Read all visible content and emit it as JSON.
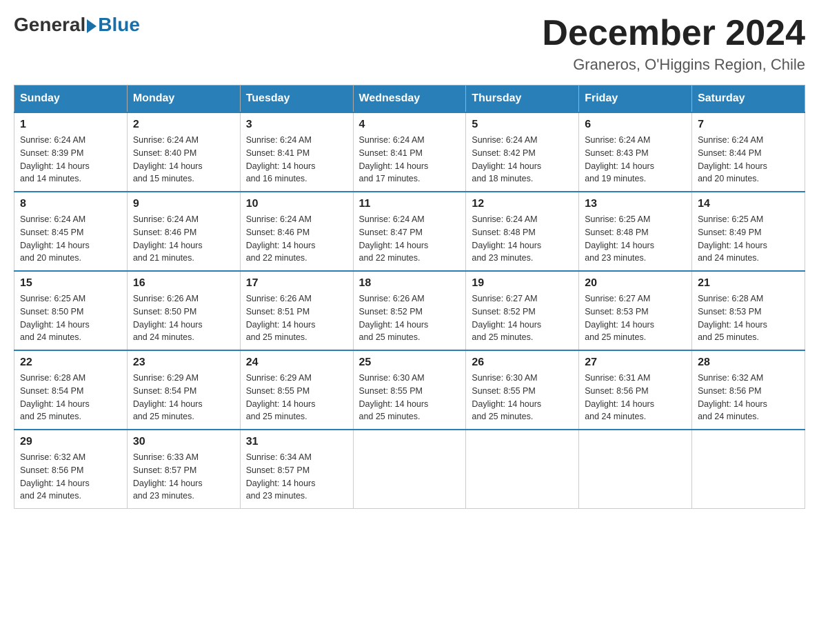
{
  "header": {
    "logo_general": "General",
    "logo_blue": "Blue",
    "month_title": "December 2024",
    "location": "Graneros, O'Higgins Region, Chile"
  },
  "days_of_week": [
    "Sunday",
    "Monday",
    "Tuesday",
    "Wednesday",
    "Thursday",
    "Friday",
    "Saturday"
  ],
  "weeks": [
    [
      {
        "day": "1",
        "sunrise": "6:24 AM",
        "sunset": "8:39 PM",
        "daylight": "14 hours and 14 minutes."
      },
      {
        "day": "2",
        "sunrise": "6:24 AM",
        "sunset": "8:40 PM",
        "daylight": "14 hours and 15 minutes."
      },
      {
        "day": "3",
        "sunrise": "6:24 AM",
        "sunset": "8:41 PM",
        "daylight": "14 hours and 16 minutes."
      },
      {
        "day": "4",
        "sunrise": "6:24 AM",
        "sunset": "8:41 PM",
        "daylight": "14 hours and 17 minutes."
      },
      {
        "day": "5",
        "sunrise": "6:24 AM",
        "sunset": "8:42 PM",
        "daylight": "14 hours and 18 minutes."
      },
      {
        "day": "6",
        "sunrise": "6:24 AM",
        "sunset": "8:43 PM",
        "daylight": "14 hours and 19 minutes."
      },
      {
        "day": "7",
        "sunrise": "6:24 AM",
        "sunset": "8:44 PM",
        "daylight": "14 hours and 20 minutes."
      }
    ],
    [
      {
        "day": "8",
        "sunrise": "6:24 AM",
        "sunset": "8:45 PM",
        "daylight": "14 hours and 20 minutes."
      },
      {
        "day": "9",
        "sunrise": "6:24 AM",
        "sunset": "8:46 PM",
        "daylight": "14 hours and 21 minutes."
      },
      {
        "day": "10",
        "sunrise": "6:24 AM",
        "sunset": "8:46 PM",
        "daylight": "14 hours and 22 minutes."
      },
      {
        "day": "11",
        "sunrise": "6:24 AM",
        "sunset": "8:47 PM",
        "daylight": "14 hours and 22 minutes."
      },
      {
        "day": "12",
        "sunrise": "6:24 AM",
        "sunset": "8:48 PM",
        "daylight": "14 hours and 23 minutes."
      },
      {
        "day": "13",
        "sunrise": "6:25 AM",
        "sunset": "8:48 PM",
        "daylight": "14 hours and 23 minutes."
      },
      {
        "day": "14",
        "sunrise": "6:25 AM",
        "sunset": "8:49 PM",
        "daylight": "14 hours and 24 minutes."
      }
    ],
    [
      {
        "day": "15",
        "sunrise": "6:25 AM",
        "sunset": "8:50 PM",
        "daylight": "14 hours and 24 minutes."
      },
      {
        "day": "16",
        "sunrise": "6:26 AM",
        "sunset": "8:50 PM",
        "daylight": "14 hours and 24 minutes."
      },
      {
        "day": "17",
        "sunrise": "6:26 AM",
        "sunset": "8:51 PM",
        "daylight": "14 hours and 25 minutes."
      },
      {
        "day": "18",
        "sunrise": "6:26 AM",
        "sunset": "8:52 PM",
        "daylight": "14 hours and 25 minutes."
      },
      {
        "day": "19",
        "sunrise": "6:27 AM",
        "sunset": "8:52 PM",
        "daylight": "14 hours and 25 minutes."
      },
      {
        "day": "20",
        "sunrise": "6:27 AM",
        "sunset": "8:53 PM",
        "daylight": "14 hours and 25 minutes."
      },
      {
        "day": "21",
        "sunrise": "6:28 AM",
        "sunset": "8:53 PM",
        "daylight": "14 hours and 25 minutes."
      }
    ],
    [
      {
        "day": "22",
        "sunrise": "6:28 AM",
        "sunset": "8:54 PM",
        "daylight": "14 hours and 25 minutes."
      },
      {
        "day": "23",
        "sunrise": "6:29 AM",
        "sunset": "8:54 PM",
        "daylight": "14 hours and 25 minutes."
      },
      {
        "day": "24",
        "sunrise": "6:29 AM",
        "sunset": "8:55 PM",
        "daylight": "14 hours and 25 minutes."
      },
      {
        "day": "25",
        "sunrise": "6:30 AM",
        "sunset": "8:55 PM",
        "daylight": "14 hours and 25 minutes."
      },
      {
        "day": "26",
        "sunrise": "6:30 AM",
        "sunset": "8:55 PM",
        "daylight": "14 hours and 25 minutes."
      },
      {
        "day": "27",
        "sunrise": "6:31 AM",
        "sunset": "8:56 PM",
        "daylight": "14 hours and 24 minutes."
      },
      {
        "day": "28",
        "sunrise": "6:32 AM",
        "sunset": "8:56 PM",
        "daylight": "14 hours and 24 minutes."
      }
    ],
    [
      {
        "day": "29",
        "sunrise": "6:32 AM",
        "sunset": "8:56 PM",
        "daylight": "14 hours and 24 minutes."
      },
      {
        "day": "30",
        "sunrise": "6:33 AM",
        "sunset": "8:57 PM",
        "daylight": "14 hours and 23 minutes."
      },
      {
        "day": "31",
        "sunrise": "6:34 AM",
        "sunset": "8:57 PM",
        "daylight": "14 hours and 23 minutes."
      },
      null,
      null,
      null,
      null
    ]
  ],
  "labels": {
    "sunrise": "Sunrise:",
    "sunset": "Sunset:",
    "daylight": "Daylight:"
  }
}
